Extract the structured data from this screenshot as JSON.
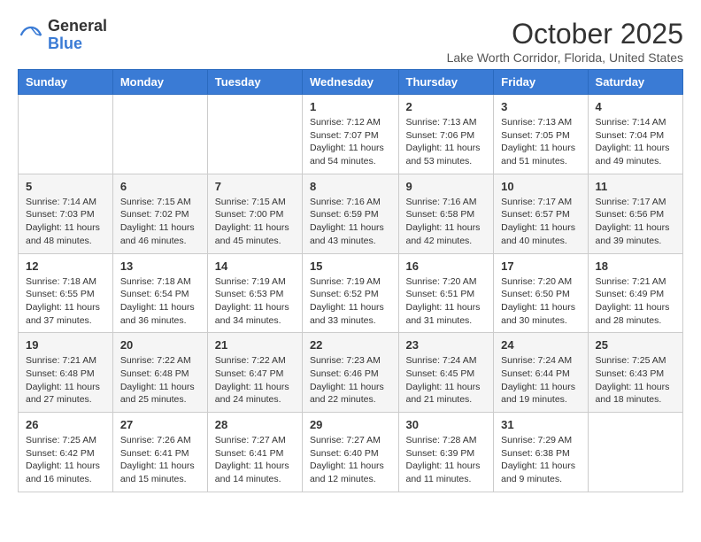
{
  "logo": {
    "general": "General",
    "blue": "Blue"
  },
  "title": "October 2025",
  "location": "Lake Worth Corridor, Florida, United States",
  "days_of_week": [
    "Sunday",
    "Monday",
    "Tuesday",
    "Wednesday",
    "Thursday",
    "Friday",
    "Saturday"
  ],
  "weeks": [
    [
      {
        "day": "",
        "info": ""
      },
      {
        "day": "",
        "info": ""
      },
      {
        "day": "",
        "info": ""
      },
      {
        "day": "1",
        "info": "Sunrise: 7:12 AM\nSunset: 7:07 PM\nDaylight: 11 hours and 54 minutes."
      },
      {
        "day": "2",
        "info": "Sunrise: 7:13 AM\nSunset: 7:06 PM\nDaylight: 11 hours and 53 minutes."
      },
      {
        "day": "3",
        "info": "Sunrise: 7:13 AM\nSunset: 7:05 PM\nDaylight: 11 hours and 51 minutes."
      },
      {
        "day": "4",
        "info": "Sunrise: 7:14 AM\nSunset: 7:04 PM\nDaylight: 11 hours and 49 minutes."
      }
    ],
    [
      {
        "day": "5",
        "info": "Sunrise: 7:14 AM\nSunset: 7:03 PM\nDaylight: 11 hours and 48 minutes."
      },
      {
        "day": "6",
        "info": "Sunrise: 7:15 AM\nSunset: 7:02 PM\nDaylight: 11 hours and 46 minutes."
      },
      {
        "day": "7",
        "info": "Sunrise: 7:15 AM\nSunset: 7:00 PM\nDaylight: 11 hours and 45 minutes."
      },
      {
        "day": "8",
        "info": "Sunrise: 7:16 AM\nSunset: 6:59 PM\nDaylight: 11 hours and 43 minutes."
      },
      {
        "day": "9",
        "info": "Sunrise: 7:16 AM\nSunset: 6:58 PM\nDaylight: 11 hours and 42 minutes."
      },
      {
        "day": "10",
        "info": "Sunrise: 7:17 AM\nSunset: 6:57 PM\nDaylight: 11 hours and 40 minutes."
      },
      {
        "day": "11",
        "info": "Sunrise: 7:17 AM\nSunset: 6:56 PM\nDaylight: 11 hours and 39 minutes."
      }
    ],
    [
      {
        "day": "12",
        "info": "Sunrise: 7:18 AM\nSunset: 6:55 PM\nDaylight: 11 hours and 37 minutes."
      },
      {
        "day": "13",
        "info": "Sunrise: 7:18 AM\nSunset: 6:54 PM\nDaylight: 11 hours and 36 minutes."
      },
      {
        "day": "14",
        "info": "Sunrise: 7:19 AM\nSunset: 6:53 PM\nDaylight: 11 hours and 34 minutes."
      },
      {
        "day": "15",
        "info": "Sunrise: 7:19 AM\nSunset: 6:52 PM\nDaylight: 11 hours and 33 minutes."
      },
      {
        "day": "16",
        "info": "Sunrise: 7:20 AM\nSunset: 6:51 PM\nDaylight: 11 hours and 31 minutes."
      },
      {
        "day": "17",
        "info": "Sunrise: 7:20 AM\nSunset: 6:50 PM\nDaylight: 11 hours and 30 minutes."
      },
      {
        "day": "18",
        "info": "Sunrise: 7:21 AM\nSunset: 6:49 PM\nDaylight: 11 hours and 28 minutes."
      }
    ],
    [
      {
        "day": "19",
        "info": "Sunrise: 7:21 AM\nSunset: 6:48 PM\nDaylight: 11 hours and 27 minutes."
      },
      {
        "day": "20",
        "info": "Sunrise: 7:22 AM\nSunset: 6:48 PM\nDaylight: 11 hours and 25 minutes."
      },
      {
        "day": "21",
        "info": "Sunrise: 7:22 AM\nSunset: 6:47 PM\nDaylight: 11 hours and 24 minutes."
      },
      {
        "day": "22",
        "info": "Sunrise: 7:23 AM\nSunset: 6:46 PM\nDaylight: 11 hours and 22 minutes."
      },
      {
        "day": "23",
        "info": "Sunrise: 7:24 AM\nSunset: 6:45 PM\nDaylight: 11 hours and 21 minutes."
      },
      {
        "day": "24",
        "info": "Sunrise: 7:24 AM\nSunset: 6:44 PM\nDaylight: 11 hours and 19 minutes."
      },
      {
        "day": "25",
        "info": "Sunrise: 7:25 AM\nSunset: 6:43 PM\nDaylight: 11 hours and 18 minutes."
      }
    ],
    [
      {
        "day": "26",
        "info": "Sunrise: 7:25 AM\nSunset: 6:42 PM\nDaylight: 11 hours and 16 minutes."
      },
      {
        "day": "27",
        "info": "Sunrise: 7:26 AM\nSunset: 6:41 PM\nDaylight: 11 hours and 15 minutes."
      },
      {
        "day": "28",
        "info": "Sunrise: 7:27 AM\nSunset: 6:41 PM\nDaylight: 11 hours and 14 minutes."
      },
      {
        "day": "29",
        "info": "Sunrise: 7:27 AM\nSunset: 6:40 PM\nDaylight: 11 hours and 12 minutes."
      },
      {
        "day": "30",
        "info": "Sunrise: 7:28 AM\nSunset: 6:39 PM\nDaylight: 11 hours and 11 minutes."
      },
      {
        "day": "31",
        "info": "Sunrise: 7:29 AM\nSunset: 6:38 PM\nDaylight: 11 hours and 9 minutes."
      },
      {
        "day": "",
        "info": ""
      }
    ]
  ]
}
